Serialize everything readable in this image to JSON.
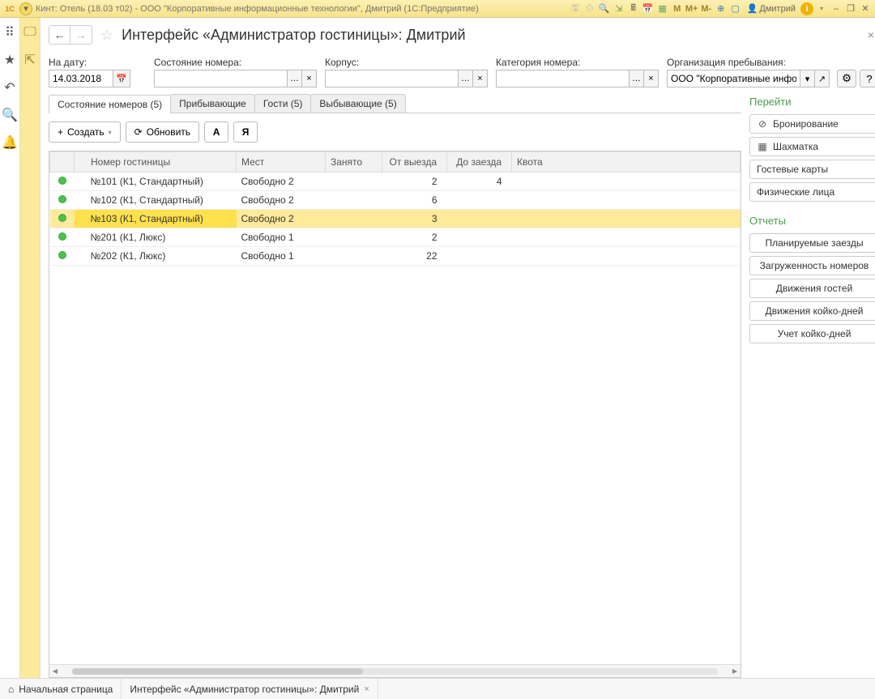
{
  "titlebar": {
    "title": "Кинт: Отель (18.03 т02) - ООО \"Корпоративные информационные технологии\", Дмитрий  (1С:Предприятие)",
    "user": "Дмитрий",
    "m_buttons": [
      "M",
      "M+",
      "M-"
    ]
  },
  "header": {
    "page_title": "Интерфейс «Администратор гостиницы»: Дмитрий"
  },
  "filters": {
    "date_label": "На дату:",
    "date_value": "14.03.2018",
    "state_label": "Состояние номера:",
    "building_label": "Корпус:",
    "category_label": "Категория номера:",
    "org_label": "Организация пребывания:",
    "org_value": "ООО \"Корпоративные инфор"
  },
  "tabs": [
    {
      "label": "Состояние номеров (5)",
      "active": true
    },
    {
      "label": "Прибывающие",
      "active": false
    },
    {
      "label": "Гости (5)",
      "active": false
    },
    {
      "label": "Выбывающие (5)",
      "active": false
    }
  ],
  "toolbar": {
    "create": "Создать",
    "refresh": "Обновить",
    "btn_a": "А",
    "btn_ya": "Я"
  },
  "table": {
    "columns": {
      "room": "Номер гостиницы",
      "seats": "Мест",
      "busy": "Занято",
      "from_out": "От выезда",
      "to_in": "До заезда",
      "quota": "Квота"
    },
    "rows": [
      {
        "room": "№101 (К1, Стандартный)",
        "seats": "Свободно 2",
        "busy": "",
        "from_out": "2",
        "to_in": "4",
        "quota": "",
        "sel": false
      },
      {
        "room": "№102 (К1, Стандартный)",
        "seats": "Свободно 2",
        "busy": "",
        "from_out": "6",
        "to_in": "",
        "quota": "",
        "sel": false
      },
      {
        "room": "№103 (К1, Стандартный)",
        "seats": "Свободно 2",
        "busy": "",
        "from_out": "3",
        "to_in": "",
        "quota": "",
        "sel": true
      },
      {
        "room": "№201 (К1, Люкс)",
        "seats": "Свободно 1",
        "busy": "",
        "from_out": "2",
        "to_in": "",
        "quota": "",
        "sel": false
      },
      {
        "room": "№202 (К1, Люкс)",
        "seats": "Свободно 1",
        "busy": "",
        "from_out": "22",
        "to_in": "",
        "quota": "",
        "sel": false
      }
    ]
  },
  "rightpanel": {
    "goto_head": "Перейти",
    "goto": [
      {
        "icon": "check",
        "label": "Бронирование"
      },
      {
        "icon": "grid",
        "label": "Шахматка"
      },
      {
        "icon": "",
        "label": "Гостевые карты"
      },
      {
        "icon": "",
        "label": "Физические лица"
      }
    ],
    "reports_head": "Отчеты",
    "reports": [
      "Планируемые заезды",
      "Загруженность номеров",
      "Движения гостей",
      "Движения койко-дней",
      "Учет койко-дней"
    ]
  },
  "bottom": {
    "home": "Начальная страница",
    "tab2": "Интерфейс «Администратор гостиницы»: Дмитрий"
  }
}
